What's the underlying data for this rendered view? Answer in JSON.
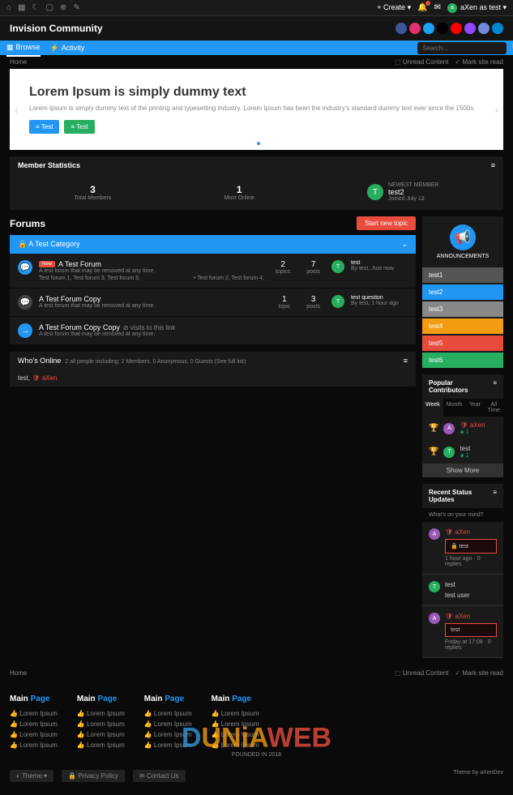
{
  "topbar": {
    "create": "+ Create ▾",
    "user": "aXen as test ▾",
    "user_initial": "a"
  },
  "header": {
    "brand": "Invision Community"
  },
  "nav": {
    "browse": "Browse",
    "activity": "Activity",
    "search_placeholder": "Search..."
  },
  "breadcrumb": {
    "home": "Home",
    "unread": "⬚ Unread Content",
    "mark_read": "✓ Mark site read"
  },
  "hero": {
    "title": "Lorem Ipsum is simply dummy text",
    "desc": "Lorem Ipsum is simply dummy text of the printing and typesetting industry. Lorem Ipsum has been the industry's standard dummy text ever since the 1500s.",
    "btn1": "≡ Test",
    "btn2": "≡ Test"
  },
  "stats": {
    "title": "Member Statistics",
    "total_members_n": "3",
    "total_members": "Total Members",
    "most_online_n": "1",
    "most_online": "Most Online",
    "newest_label": "NEWEST MEMBER",
    "newest_name": "test2",
    "newest_date": "Joined July 13",
    "newest_initial": "T"
  },
  "forums": {
    "title": "Forums",
    "start_topic": "Start new topic",
    "category": "A Test Category",
    "items": [
      {
        "icon_bg": "#2196f3",
        "new": "New",
        "title": "A Test Forum",
        "desc": "A test forum that may be removed at any time.",
        "subs": "Test forum 1,   Test forum 3,   Test forum 5,",
        "subs2": "• Test forum 2,   Test forum 4,",
        "topics_n": "2",
        "topics": "topics",
        "posts_n": "7",
        "posts": "posts",
        "last_title": "test",
        "last_meta": "By test, Just now",
        "last_initial": "T",
        "last_bg": "#27ae60"
      },
      {
        "icon_bg": "#444",
        "title": "A Test Forum Copy",
        "desc": "A test forum that may be removed at any time.",
        "topics_n": "1",
        "topics": "topic",
        "posts_n": "3",
        "posts": "posts",
        "last_title": "test question",
        "last_meta": "By test, 1 hour ago",
        "last_initial": "T",
        "last_bg": "#27ae60"
      },
      {
        "icon_bg": "#2196f3",
        "icon_sym": "→",
        "title": "A Test Forum Copy Copy",
        "suffix": "⊘ visits to this link",
        "desc": "A test forum that may be removed at any time."
      }
    ]
  },
  "online": {
    "title": "Who's Online",
    "sub": "2 all people including: 2 Members, 0 Anonymous, 0 Guests (See full list)",
    "list_pre": "test, ",
    "list_admin": "aXen"
  },
  "announcements": {
    "label": "ANNOUNCEMENTS",
    "items": [
      {
        "label": "test1",
        "bg": "#555"
      },
      {
        "label": "test2",
        "bg": "#2196f3"
      },
      {
        "label": "test3",
        "bg": "#888"
      },
      {
        "label": "test4",
        "bg": "#f39c12"
      },
      {
        "label": "test5",
        "bg": "#e74c3c"
      },
      {
        "label": "test6",
        "bg": "#27ae60"
      }
    ]
  },
  "contributors": {
    "title": "Popular Contributors",
    "tabs": {
      "week": "Week",
      "month": "Month",
      "year": "Year",
      "all": "All Time"
    },
    "items": [
      {
        "initial": "A",
        "bg": "#9b59b6",
        "name": "aXen",
        "name_class": "red",
        "rep": "◈ 1"
      },
      {
        "initial": "T",
        "bg": "#27ae60",
        "name": "test",
        "rep": "◈ 1"
      }
    ],
    "show_more": "Show More"
  },
  "status": {
    "title": "Recent Status Updates",
    "placeholder": "What's on your mind?",
    "items": [
      {
        "initial": "A",
        "bg": "#9b59b6",
        "name": "aXen",
        "name_class": "red",
        "box": "🔒 test",
        "meta": "1 hour ago · 0 replies"
      },
      {
        "initial": "T",
        "bg": "#27ae60",
        "name": "test",
        "text": "test user",
        "meta": ""
      },
      {
        "initial": "A",
        "bg": "#9b59b6",
        "name": "aXen",
        "name_class": "red",
        "box": "test",
        "meta": "Friday at 17:08 · 0 replies"
      }
    ]
  },
  "footer": {
    "main": "Main",
    "page": "Page",
    "link": "Lorem Ipsum",
    "theme": "◐ Theme ▾",
    "privacy": "🔒 Privacy Policy",
    "contact": "✉ Contact Us",
    "powered": "Theme by aXenDev"
  },
  "watermark": {
    "d": "D",
    "unia": "UNiA",
    "web": "WEB",
    "sub": "FOUNDED IN 2018"
  },
  "socials": [
    {
      "bg": "#3b5998"
    },
    {
      "bg": "#e1306c"
    },
    {
      "bg": "#1da1f2"
    },
    {
      "bg": "#000"
    },
    {
      "bg": "#ff0000"
    },
    {
      "bg": "#9146ff"
    },
    {
      "bg": "#7289da"
    },
    {
      "bg": "#0088cc"
    }
  ]
}
